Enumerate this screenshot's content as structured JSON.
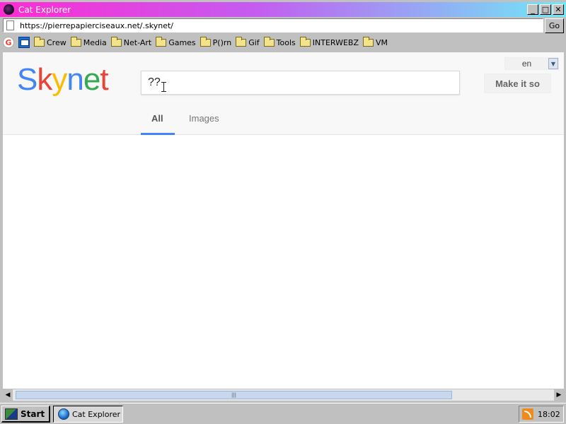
{
  "window": {
    "title": "Cat Explorer",
    "minimize": "_",
    "maximize": "□",
    "close": "✕"
  },
  "address": {
    "url": "https://pierrepapierciseaux.net/.skynet/",
    "go_label": "Go"
  },
  "bookmarks": [
    {
      "label": "Crew"
    },
    {
      "label": "Media"
    },
    {
      "label": "Net-Art"
    },
    {
      "label": "Games"
    },
    {
      "label": "P()rn"
    },
    {
      "label": "Gif"
    },
    {
      "label": "Tools"
    },
    {
      "label": "INTERWEBZ"
    },
    {
      "label": "VM"
    }
  ],
  "bookmark_icons": {
    "google": "G"
  },
  "page": {
    "logo": [
      "S",
      "k",
      "y",
      "n",
      "e",
      "t"
    ],
    "logo_colors": [
      "#4285f4",
      "#ea4335",
      "#fbbc05",
      "#4285f4",
      "#34a853",
      "#ea4335"
    ],
    "search_value": "??",
    "language": "en",
    "make_button": "Make it so",
    "tabs": {
      "all": "All",
      "images": "Images"
    },
    "active_tab": "All",
    "accent": "#4285f4"
  },
  "scrollbar": {
    "left": "◀",
    "right": "▶",
    "grip": "|||"
  },
  "taskbar": {
    "start_label": "Start",
    "task_label": "Cat Explorer",
    "clock": "18:02"
  }
}
